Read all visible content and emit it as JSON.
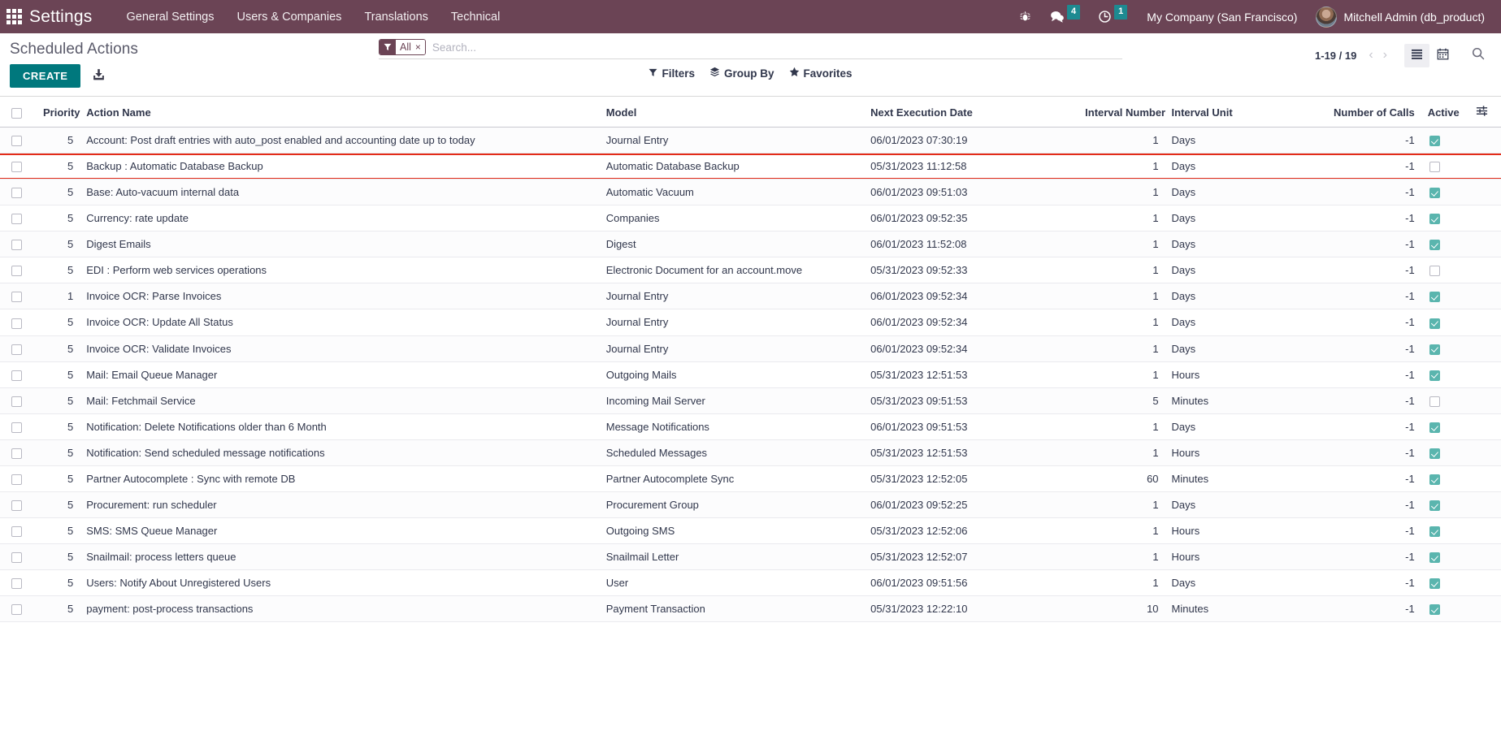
{
  "navbar": {
    "apps_icon": "apps-grid-icon",
    "brand": "Settings",
    "menu": [
      "General Settings",
      "Users & Companies",
      "Translations",
      "Technical"
    ],
    "sys_icons": [
      {
        "name": "bug-icon",
        "glyph": "⚙",
        "badge": null
      },
      {
        "name": "messages-icon",
        "glyph": "💬",
        "badge": "4"
      },
      {
        "name": "activities-clock-icon",
        "glyph": "⏱",
        "badge": "1"
      }
    ],
    "company": "My Company (San Francisco)",
    "user": "Mitchell Admin (db_product)",
    "bg_color": "#6b4455",
    "badge_color": "#1d8a91"
  },
  "control_panel": {
    "breadcrumb": "Scheduled Actions",
    "create_label": "CREATE",
    "upload_icon": "import-records-icon",
    "search": {
      "facet_icon": "filter-funnel-icon",
      "facet_label": "All",
      "facet_remove": "×",
      "placeholder": "Search...",
      "value": ""
    },
    "dropdowns": [
      {
        "name": "filters",
        "icon": "funnel-icon",
        "label": "Filters"
      },
      {
        "name": "group-by",
        "icon": "layers-icon",
        "label": "Group By"
      },
      {
        "name": "favorites",
        "icon": "star-icon",
        "label": "Favorites"
      }
    ],
    "pager": "1-19 / 19",
    "prev_glyph": "‹",
    "next_glyph": "›",
    "views": [
      {
        "name": "list-view",
        "icon": "list-icon",
        "active": true
      },
      {
        "name": "calendar-view",
        "icon": "calendar-icon",
        "active": false
      }
    ],
    "search_toggle_icon": "magnifier-icon"
  },
  "table": {
    "columns": [
      "Priority",
      "Action Name",
      "Model",
      "Next Execution Date",
      "Interval Number",
      "Interval Unit",
      "Number of Calls",
      "Active"
    ],
    "optional_toggle_icon": "optional-columns-icon",
    "rows": [
      {
        "priority": "5",
        "name": "Account: Post draft entries with auto_post enabled and accounting date up to today",
        "model": "Journal Entry",
        "next_execution": "06/01/2023 07:30:19",
        "interval_number": "1",
        "interval_unit": "Days",
        "calls": "-1",
        "active": true,
        "muted": false,
        "highlighted": false
      },
      {
        "priority": "5",
        "name": "Backup : Automatic Database Backup",
        "model": "Automatic Database Backup",
        "next_execution": "05/31/2023 11:12:58",
        "interval_number": "1",
        "interval_unit": "Days",
        "calls": "-1",
        "active": false,
        "muted": true,
        "highlighted": true
      },
      {
        "priority": "5",
        "name": "Base: Auto-vacuum internal data",
        "model": "Automatic Vacuum",
        "next_execution": "06/01/2023 09:51:03",
        "interval_number": "1",
        "interval_unit": "Days",
        "calls": "-1",
        "active": true,
        "muted": false,
        "highlighted": false
      },
      {
        "priority": "5",
        "name": "Currency: rate update",
        "model": "Companies",
        "next_execution": "06/01/2023 09:52:35",
        "interval_number": "1",
        "interval_unit": "Days",
        "calls": "-1",
        "active": true,
        "muted": false,
        "highlighted": false
      },
      {
        "priority": "5",
        "name": "Digest Emails",
        "model": "Digest",
        "next_execution": "06/01/2023 11:52:08",
        "interval_number": "1",
        "interval_unit": "Days",
        "calls": "-1",
        "active": true,
        "muted": false,
        "highlighted": false
      },
      {
        "priority": "5",
        "name": "EDI : Perform web services operations",
        "model": "Electronic Document for an account.move",
        "next_execution": "05/31/2023 09:52:33",
        "interval_number": "1",
        "interval_unit": "Days",
        "calls": "-1",
        "active": false,
        "muted": true,
        "highlighted": false
      },
      {
        "priority": "1",
        "name": "Invoice OCR: Parse Invoices",
        "model": "Journal Entry",
        "next_execution": "06/01/2023 09:52:34",
        "interval_number": "1",
        "interval_unit": "Days",
        "calls": "-1",
        "active": true,
        "muted": false,
        "highlighted": false
      },
      {
        "priority": "5",
        "name": "Invoice OCR: Update All Status",
        "model": "Journal Entry",
        "next_execution": "06/01/2023 09:52:34",
        "interval_number": "1",
        "interval_unit": "Days",
        "calls": "-1",
        "active": true,
        "muted": false,
        "highlighted": false
      },
      {
        "priority": "5",
        "name": "Invoice OCR: Validate Invoices",
        "model": "Journal Entry",
        "next_execution": "06/01/2023 09:52:34",
        "interval_number": "1",
        "interval_unit": "Days",
        "calls": "-1",
        "active": true,
        "muted": false,
        "highlighted": false
      },
      {
        "priority": "5",
        "name": "Mail: Email Queue Manager",
        "model": "Outgoing Mails",
        "next_execution": "05/31/2023 12:51:53",
        "interval_number": "1",
        "interval_unit": "Hours",
        "calls": "-1",
        "active": true,
        "muted": false,
        "highlighted": false
      },
      {
        "priority": "5",
        "name": "Mail: Fetchmail Service",
        "model": "Incoming Mail Server",
        "next_execution": "05/31/2023 09:51:53",
        "interval_number": "5",
        "interval_unit": "Minutes",
        "calls": "-1",
        "active": false,
        "muted": true,
        "highlighted": false
      },
      {
        "priority": "5",
        "name": "Notification: Delete Notifications older than 6 Month",
        "model": "Message Notifications",
        "next_execution": "06/01/2023 09:51:53",
        "interval_number": "1",
        "interval_unit": "Days",
        "calls": "-1",
        "active": true,
        "muted": false,
        "highlighted": false
      },
      {
        "priority": "5",
        "name": "Notification: Send scheduled message notifications",
        "model": "Scheduled Messages",
        "next_execution": "05/31/2023 12:51:53",
        "interval_number": "1",
        "interval_unit": "Hours",
        "calls": "-1",
        "active": true,
        "muted": false,
        "highlighted": false
      },
      {
        "priority": "5",
        "name": "Partner Autocomplete : Sync with remote DB",
        "model": "Partner Autocomplete Sync",
        "next_execution": "05/31/2023 12:52:05",
        "interval_number": "60",
        "interval_unit": "Minutes",
        "calls": "-1",
        "active": true,
        "muted": false,
        "highlighted": false
      },
      {
        "priority": "5",
        "name": "Procurement: run scheduler",
        "model": "Procurement Group",
        "next_execution": "06/01/2023 09:52:25",
        "interval_number": "1",
        "interval_unit": "Days",
        "calls": "-1",
        "active": true,
        "muted": false,
        "highlighted": false
      },
      {
        "priority": "5",
        "name": "SMS: SMS Queue Manager",
        "model": "Outgoing SMS",
        "next_execution": "05/31/2023 12:52:06",
        "interval_number": "1",
        "interval_unit": "Hours",
        "calls": "-1",
        "active": true,
        "muted": false,
        "highlighted": false
      },
      {
        "priority": "5",
        "name": "Snailmail: process letters queue",
        "model": "Snailmail Letter",
        "next_execution": "05/31/2023 12:52:07",
        "interval_number": "1",
        "interval_unit": "Hours",
        "calls": "-1",
        "active": true,
        "muted": false,
        "highlighted": false
      },
      {
        "priority": "5",
        "name": "Users: Notify About Unregistered Users",
        "model": "User",
        "next_execution": "06/01/2023 09:51:56",
        "interval_number": "1",
        "interval_unit": "Days",
        "calls": "-1",
        "active": true,
        "muted": false,
        "highlighted": false
      },
      {
        "priority": "5",
        "name": "payment: post-process transactions",
        "model": "Payment Transaction",
        "next_execution": "05/31/2023 12:22:10",
        "interval_number": "10",
        "interval_unit": "Minutes",
        "calls": "-1",
        "active": true,
        "muted": false,
        "highlighted": false
      }
    ]
  },
  "colors": {
    "brand_purple": "#6b4455",
    "accent_teal": "#00787d",
    "checkbox_teal": "#5ab5ae",
    "highlight_red": "#e32b19"
  }
}
